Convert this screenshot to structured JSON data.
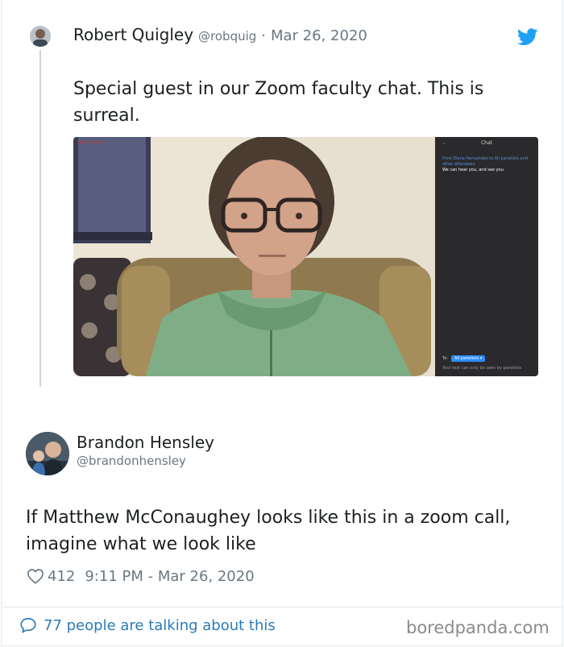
{
  "tweet1": {
    "author_name": "Robert Quigley",
    "handle": "@robquig",
    "separator": "·",
    "date": "Mar 26, 2020",
    "text": "Special guest in our Zoom faculty chat. This is surreal.",
    "avatar_icon": "avatar-icon",
    "platform_icon": "twitter-bird-icon",
    "media": {
      "recording_label": "● Recording",
      "chat": {
        "chevron": "⌄",
        "title": "Chat",
        "from": "From Elena Hernandez to All panelists and other attendees:",
        "message": "We can hear you, and see you.",
        "to_label": "To:",
        "to_value": "All panelists ▾",
        "note": "Your text can only be seen by panelists"
      }
    }
  },
  "tweet2": {
    "author_name": "Brandon Hensley",
    "handle": "@brandonhensley",
    "text": "If Matthew McConaughey looks like this in a zoom call, imagine what we look like",
    "likes": "412",
    "time": "9:11 PM - Mar 26, 2020",
    "like_icon": "heart-icon"
  },
  "footer": {
    "talking": "77 people are talking about this",
    "talking_icon": "speech-bubble-icon",
    "brand": "boredpanda.com"
  },
  "colors": {
    "link_blue": "#2b7bb9",
    "twitter_blue": "#1da1f2",
    "meta_gray": "#697882",
    "zoom_blue": "#2d8cff"
  }
}
